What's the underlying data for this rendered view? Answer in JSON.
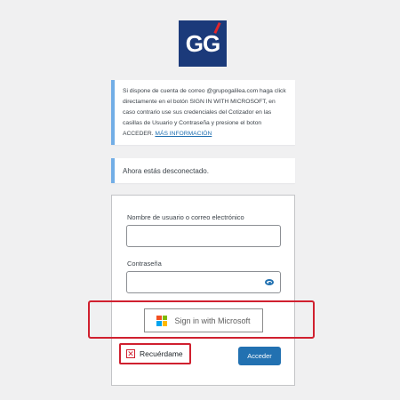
{
  "logo": {
    "text": "GG"
  },
  "notice_info": {
    "text": "Si dispone de cuenta de correo @grupogalilea.com haga click directamente en el botón SIGN IN WITH MICROSOFT, en caso contrario use sus credenciales del Cotizador en las casillas de Usuario y Contraseña y presione el boton ACCEDER. ",
    "link_text": "MÁS INFORMACIÓN"
  },
  "notice_logout": {
    "text": "Ahora estás desconectado."
  },
  "login_form": {
    "username_label": "Nombre de usuario o correo electrónico",
    "username_value": "",
    "password_label": "Contraseña",
    "password_value": "",
    "microsoft_button_label": "Sign in with Microsoft",
    "remember_label": "Recuérdame",
    "remember_mark": "✕",
    "submit_label": "Acceder"
  },
  "colors": {
    "background": "#f0f0f1",
    "logo_bg": "#1b3a7a",
    "accent": "#2271b1",
    "notice_border": "#72aee6",
    "highlight_red": "#d0202f"
  }
}
